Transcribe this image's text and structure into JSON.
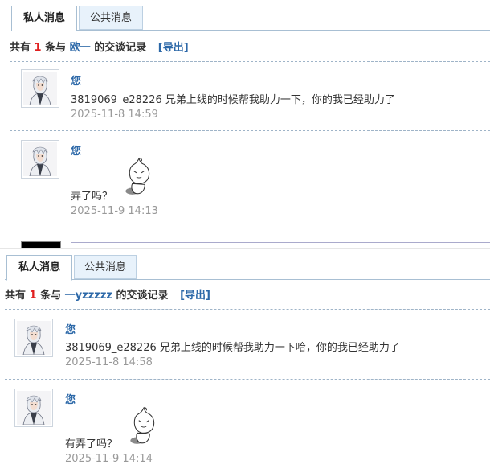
{
  "colors": {
    "accent": "#2c68a8",
    "count_red": "#e01f1f",
    "tab_border": "#a8bfd3",
    "tab_inactive_bg": "#e8f2fb",
    "time_gray": "#999999"
  },
  "panels": [
    {
      "tabs": [
        {
          "label": "私人消息",
          "active": true
        },
        {
          "label": "公共消息",
          "active": false
        }
      ],
      "summary": {
        "prefix": "共有",
        "count": "1",
        "middle": "条与",
        "partner": "欧一",
        "suffix": "的交谈记录",
        "export": "[导出]"
      },
      "messages": [
        {
          "sender": "您",
          "text": "3819069_e28226 兄弟上线的时候帮我助力一下，你的我已经助力了",
          "time": "2025-11-8 14:59",
          "avatar_icon": "white-haired-character-avatar"
        },
        {
          "sender": "您",
          "text": "弄了吗？",
          "time": "2025-11-9 14:13",
          "avatar_icon": "white-haired-character-avatar",
          "sticker_icon": "onion-head-emoji-sticker"
        }
      ]
    },
    {
      "tabs": [
        {
          "label": "私人消息",
          "active": true
        },
        {
          "label": "公共消息",
          "active": false
        }
      ],
      "summary": {
        "prefix": "共有",
        "count": "1",
        "middle": "条与",
        "partner": "一yzzzzz",
        "suffix": "的交谈记录",
        "export": "[导出]"
      },
      "messages": [
        {
          "sender": "您",
          "text": "3819069_e28226 兄弟上线的时候帮我助力一下哈，你的我已经助力了",
          "time": "2025-11-8 14:58",
          "avatar_icon": "white-haired-character-avatar"
        },
        {
          "sender": "您",
          "text": "有弄了吗？",
          "time": "2025-11-9 14:14",
          "avatar_icon": "white-haired-character-avatar",
          "sticker_icon": "onion-head-emoji-sticker"
        }
      ]
    }
  ]
}
